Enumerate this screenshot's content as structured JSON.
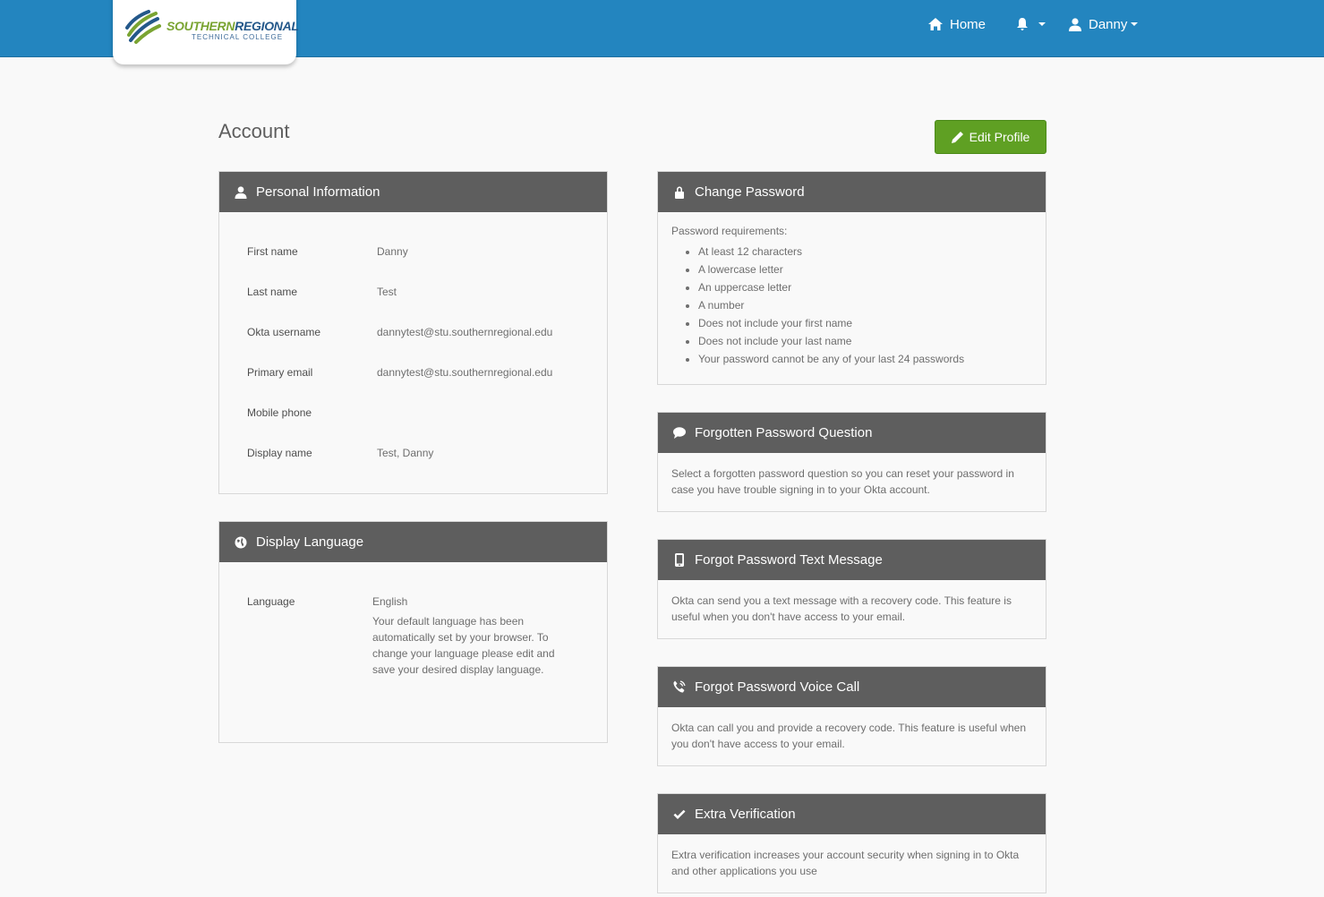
{
  "header": {
    "logo": {
      "line1_a": "SOUTHERN",
      "line1_b": "REGIONAL",
      "line2": "TECHNICAL COLLEGE"
    },
    "nav": {
      "home_label": "Home",
      "user_label": "Danny"
    }
  },
  "page": {
    "title": "Account",
    "edit_button_label": "Edit Profile"
  },
  "personal_info": {
    "title": "Personal Information",
    "fields": [
      {
        "label": "First name",
        "value": "Danny"
      },
      {
        "label": "Last name",
        "value": "Test"
      },
      {
        "label": "Okta username",
        "value": "dannytest@stu.southernregional.edu"
      },
      {
        "label": "Primary email",
        "value": "dannytest@stu.southernregional.edu"
      },
      {
        "label": "Mobile phone",
        "value": ""
      },
      {
        "label": "Display name",
        "value": "Test, Danny"
      }
    ]
  },
  "display_language": {
    "title": "Display Language",
    "label": "Language",
    "value": "English",
    "help": "Your default language has been automatically set by your browser. To change your language please edit and save your desired display language."
  },
  "change_password": {
    "title": "Change Password",
    "intro": "Password requirements:",
    "requirements": [
      "At least 12 characters",
      "A lowercase letter",
      "An uppercase letter",
      "A number",
      "Does not include your first name",
      "Does not include your last name",
      "Your password cannot be any of your last 24 passwords"
    ]
  },
  "forgotten_question": {
    "title": "Forgotten Password Question",
    "text": "Select a forgotten password question so you can reset your password in case you have trouble signing in to your Okta account."
  },
  "forgot_text": {
    "title": "Forgot Password Text Message",
    "text": "Okta can send you a text message with a recovery code. This feature is useful when you don't have access to your email."
  },
  "forgot_voice": {
    "title": "Forgot Password Voice Call",
    "text": "Okta can call you and provide a recovery code. This feature is useful when you don't have access to your email."
  },
  "extra_verification": {
    "title": "Extra Verification",
    "text": "Extra verification increases your account security when signing in to Okta and other applications you use"
  },
  "colors": {
    "topbar": "#2385bf",
    "panel_header": "#5e5e5e",
    "edit_button": "#5fa023"
  }
}
